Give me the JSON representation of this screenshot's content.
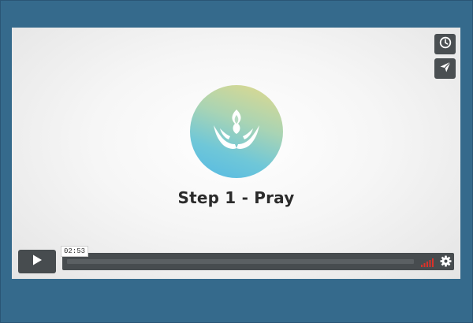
{
  "player": {
    "title": "Step 1 - Pray",
    "current_time": "02:53",
    "progress_fraction": 0.0,
    "volume_level": "high",
    "buttons": {
      "play": "play-icon",
      "watch_later": "clock-icon",
      "share": "send-icon",
      "settings": "gear-icon"
    },
    "logo": "praying-hands-flame-icon"
  },
  "colors": {
    "page_background": "#356a8c",
    "control_background": "#474c4f",
    "volume_accent": "#d9322a",
    "title_text": "#2b2b2b"
  }
}
